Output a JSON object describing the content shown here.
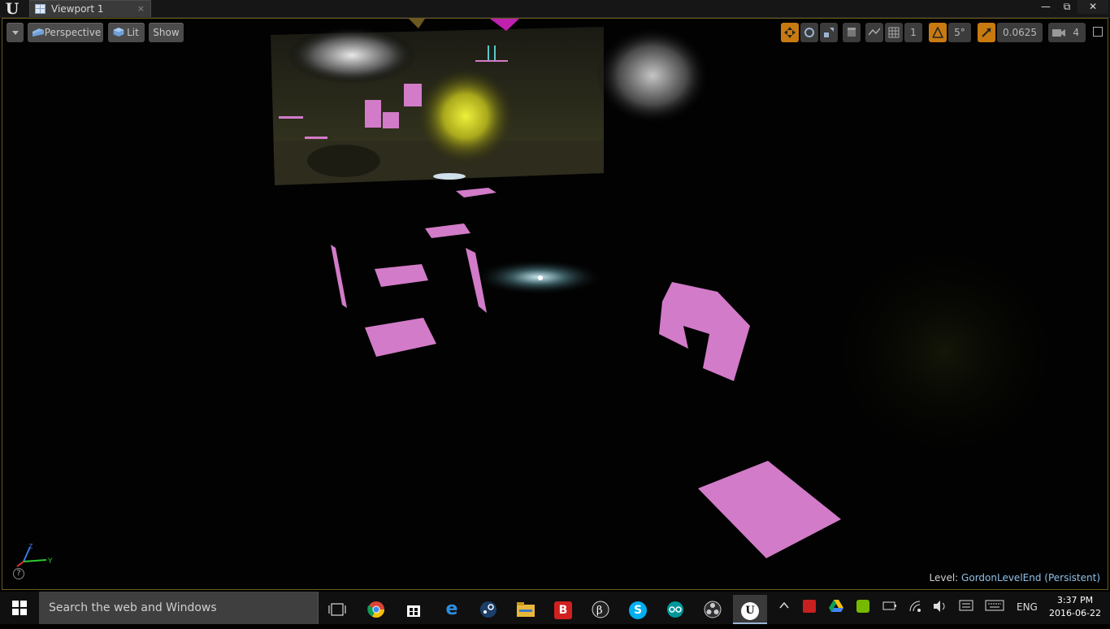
{
  "window": {
    "tab_title": "Viewport 1",
    "tab_close": "×",
    "controls": {
      "minimize": "—",
      "maximize": "⧉",
      "close": "✕"
    }
  },
  "toolbar": {
    "view_mode": "Perspective",
    "lighting": "Lit",
    "show": "Show",
    "grid_snap_value": "1",
    "rotation_snap_value": "5°",
    "scale_snap_value": "0.0625",
    "camera_speed": "4"
  },
  "status": {
    "level_label": "Level:",
    "level_name": "GordonLevelEnd (Persistent)"
  },
  "axis": {
    "z": "Z",
    "y": "Y",
    "x": "X"
  },
  "help": "?",
  "taskbar": {
    "search_placeholder": "Search the web and Windows",
    "language": "ENG",
    "time": "3:37 PM",
    "date": "2016-06-22",
    "apps": [
      "task-view",
      "chrome",
      "store",
      "edge",
      "steam",
      "file-explorer",
      "bandicam",
      "blender",
      "skype",
      "arduino",
      "obs",
      "unreal-engine"
    ]
  },
  "colors": {
    "accent_orange": "#c87a10",
    "pink_planes": "#d27bc8",
    "level_name": "#8fc0e8"
  }
}
